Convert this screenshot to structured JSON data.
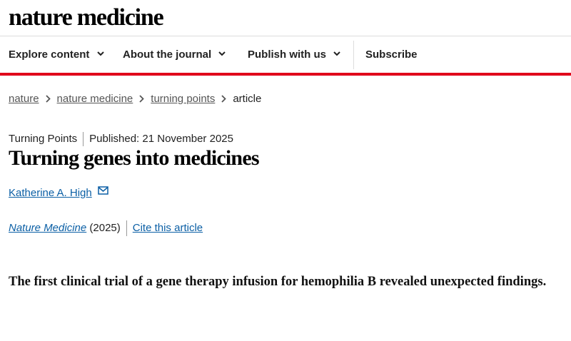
{
  "site": {
    "logo": "nature medicine"
  },
  "nav": {
    "explore_label": "Explore content",
    "about_label": "About the journal",
    "publish_label": "Publish with us",
    "subscribe_label": "Subscribe"
  },
  "breadcrumb": {
    "items": [
      "nature",
      "nature medicine",
      "turning points"
    ],
    "current": "article"
  },
  "article": {
    "type": "Turning Points",
    "published": "Published: 21 November 2025",
    "title": "Turning genes into medicines",
    "author": "Katherine A. High",
    "journal": "Nature Medicine",
    "year": "(2025)",
    "cite_label": "Cite this article",
    "standfirst": "The first clinical trial of a gene therapy infusion for hemophilia B revealed unexpected findings."
  },
  "colors": {
    "accent_red": "#e0001b",
    "link_blue": "#0b5fa5"
  }
}
